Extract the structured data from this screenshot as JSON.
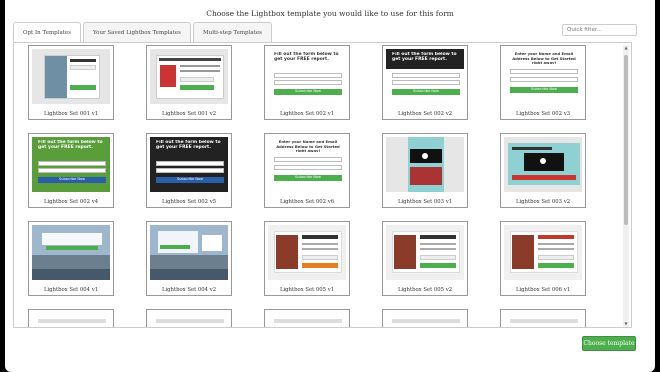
{
  "title": "Choose the Lightbox template you would like to use for this form",
  "tabs": [
    {
      "label": "Opt In Templates",
      "active": true
    },
    {
      "label": "Your Saved Lightbox Templates",
      "active": false
    },
    {
      "label": "Multi-step Templates",
      "active": false
    }
  ],
  "filter_placeholder": "Quick filter...",
  "templates": [
    {
      "label": "Lightbox Set 001 v1",
      "style": "photo"
    },
    {
      "label": "Lightbox Set 001 v2",
      "style": "ebook"
    },
    {
      "label": "Lightbox Set 002 v1",
      "style": "form-white"
    },
    {
      "label": "Lightbox Set 002 v2",
      "style": "form-dark"
    },
    {
      "label": "Lightbox Set 002 v3",
      "style": "form-email"
    },
    {
      "label": "Lightbox Set 002 v4",
      "style": "form-green"
    },
    {
      "label": "Lightbox Set 002 v5",
      "style": "form-black"
    },
    {
      "label": "Lightbox Set 002 v6",
      "style": "form-email"
    },
    {
      "label": "Lightbox Set 003 v1",
      "style": "video-teal"
    },
    {
      "label": "Lightbox Set 003 v2",
      "style": "video-teal2"
    },
    {
      "label": "Lightbox Set 004 v1",
      "style": "city"
    },
    {
      "label": "Lightbox Set 004 v2",
      "style": "city2"
    },
    {
      "label": "Lightbox Set 005 v1",
      "style": "food"
    },
    {
      "label": "Lightbox Set 005 v2",
      "style": "food2"
    },
    {
      "label": "Lightbox Set 006 v1",
      "style": "food3"
    },
    {
      "label": "",
      "style": "partial"
    },
    {
      "label": "",
      "style": "partial"
    },
    {
      "label": "",
      "style": "partial"
    },
    {
      "label": "",
      "style": "partial"
    },
    {
      "label": "",
      "style": "partial"
    }
  ],
  "thumb_texts": {
    "fill_form": "Fill out the form below to get your FREE report.",
    "enter_email": "Enter your Name and Email Address Below to Get Started right away!",
    "subscribe": "Subscribe Now"
  },
  "choose_button": "Choose template",
  "colors": {
    "green": "#4cae4c",
    "teal": "#8fd1d3",
    "dark": "#222222"
  }
}
